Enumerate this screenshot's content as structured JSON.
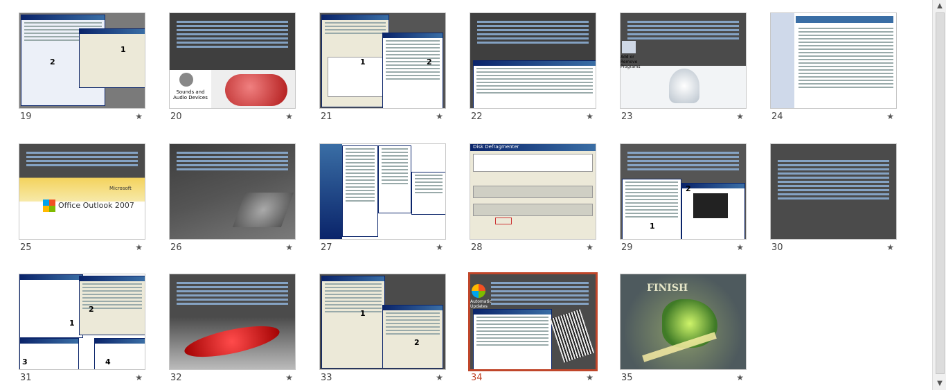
{
  "slides": [
    {
      "n": "19"
    },
    {
      "n": "20"
    },
    {
      "n": "21"
    },
    {
      "n": "22"
    },
    {
      "n": "23"
    },
    {
      "n": "24"
    },
    {
      "n": "25"
    },
    {
      "n": "26"
    },
    {
      "n": "27"
    },
    {
      "n": "28"
    },
    {
      "n": "29"
    },
    {
      "n": "30"
    },
    {
      "n": "31"
    },
    {
      "n": "32"
    },
    {
      "n": "33"
    },
    {
      "n": "34"
    },
    {
      "n": "35"
    }
  ],
  "star": "★",
  "selected": "34",
  "labels": {
    "sound": "Sounds and Audio Devices",
    "add_remove": "Add or Remove Programs",
    "office": "Office Outlook 2007",
    "microsoft": "Microsoft",
    "defrag_title": "Disk Defragmenter",
    "auto_update": "Automatic Updates",
    "finish": "FINISH"
  },
  "scroll": {
    "up": "▲",
    "down": "▼"
  }
}
